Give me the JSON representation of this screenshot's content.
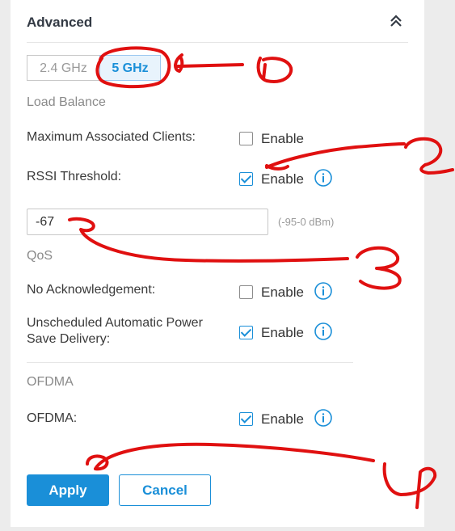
{
  "header": {
    "title": "Advanced"
  },
  "band": {
    "options": [
      "2.4 GHz",
      "5 GHz"
    ],
    "selected": "5 GHz"
  },
  "load_balance": {
    "section_title": "Load Balance",
    "max_clients": {
      "label": "Maximum Associated Clients:",
      "checked": false,
      "option": "Enable"
    },
    "rssi": {
      "label": "RSSI Threshold:",
      "checked": true,
      "option": "Enable",
      "value": "-67",
      "hint": "(-95-0 dBm)"
    }
  },
  "qos": {
    "section_title": "QoS",
    "no_ack": {
      "label": "No Acknowledgement:",
      "checked": false,
      "option": "Enable"
    },
    "uapsd": {
      "label_line1": "Unscheduled Automatic Power",
      "label_line2": "Save Delivery:",
      "checked": true,
      "option": "Enable"
    }
  },
  "ofdma": {
    "section_title": "OFDMA",
    "ofdma": {
      "label": "OFDMA:",
      "checked": true,
      "option": "Enable"
    }
  },
  "buttons": {
    "apply": "Apply",
    "cancel": "Cancel"
  },
  "colors": {
    "accent": "#1a8fd8",
    "annotation": "#e01010"
  }
}
